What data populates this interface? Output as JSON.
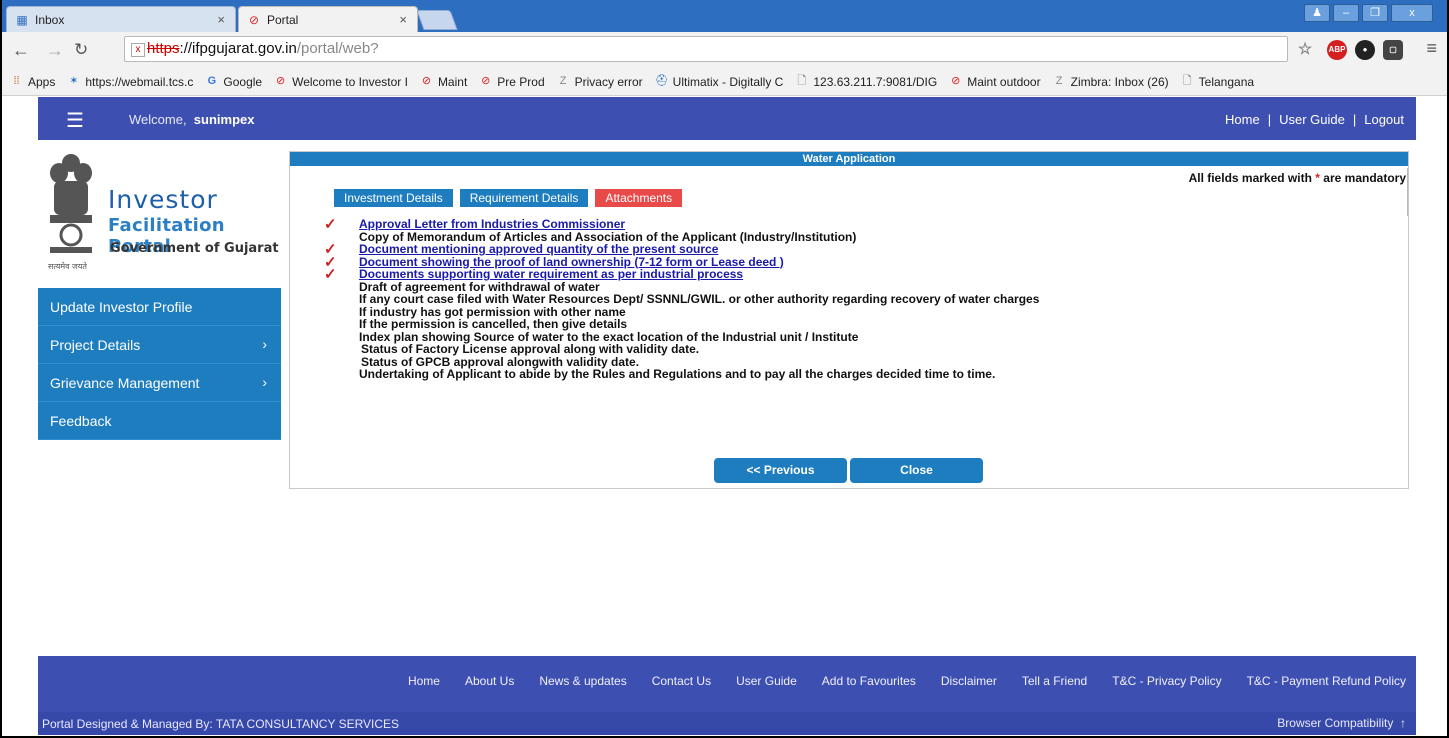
{
  "browser": {
    "tabs": [
      {
        "title": "Inbox",
        "icon": "mail-icon"
      },
      {
        "title": "Portal",
        "icon": "portal-icon"
      }
    ],
    "url": {
      "scheme": "https",
      "host": "://ifpgujarat.gov.in",
      "path": "/portal/web?"
    },
    "bookmarks": [
      "Apps",
      "https://webmail.tcs.c",
      "Google",
      "Welcome to Investor I",
      "Maint",
      "Pre Prod",
      "Privacy error",
      "Ultimatix - Digitally C",
      "123.63.211.7:9081/DIG",
      "Maint outdoor",
      "Zimbra: Inbox (26)",
      "Telangana"
    ]
  },
  "header": {
    "welcome_prefix": "Welcome,",
    "username": "sunimpex",
    "links": [
      "Home",
      "User Guide",
      "Logout"
    ],
    "separator": "|"
  },
  "logo": {
    "line1": "Investor",
    "line2": "Facilitation Portal",
    "line3": "Government of Gujarat",
    "motto": "सत्यमेव जयते"
  },
  "sidebar": {
    "items": [
      {
        "label": "Update Investor Profile",
        "chevron": false
      },
      {
        "label": "Project Details",
        "chevron": true
      },
      {
        "label": "Grievance Management",
        "chevron": true
      },
      {
        "label": "Feedback",
        "chevron": false
      }
    ]
  },
  "content": {
    "title": "Water Application",
    "mandatory_prefix": "All fields marked with",
    "mandatory_star": "*",
    "mandatory_suffix": "are mandatory",
    "tabs": [
      "Investment Details",
      "Requirement Details",
      "Attachments"
    ],
    "documents": [
      {
        "text": "Approval Letter from Industries Commissioner",
        "checked": true,
        "link": true
      },
      {
        "text": "Copy of Memorandum of Articles and Association of the Applicant (Industry/Institution)",
        "checked": false,
        "link": false
      },
      {
        "text": "Document mentioning approved quantity of the present source",
        "checked": true,
        "link": true
      },
      {
        "text": "Document showing the proof of land ownership (7-12 form or Lease deed )",
        "checked": true,
        "link": true
      },
      {
        "text": "Documents supporting water requirement as per industrial process",
        "checked": true,
        "link": true
      },
      {
        "text": "Draft of agreement for withdrawal of water",
        "checked": false,
        "link": false
      },
      {
        "text": "If any court case filed with Water Resources Dept/ SSNNL/GWIL. or other authority regarding recovery of water charges",
        "checked": false,
        "link": false
      },
      {
        "text": "If industry has got permission with other name",
        "checked": false,
        "link": false
      },
      {
        "text": "If the permission is cancelled, then give details",
        "checked": false,
        "link": false
      },
      {
        "text": "Index plan showing Source of water to the exact location of the Industrial unit / Institute",
        "checked": false,
        "link": false
      },
      {
        "text": "Status of Factory License approval along with validity date.",
        "checked": false,
        "link": false
      },
      {
        "text": "Status of GPCB approval alongwith validity date.",
        "checked": false,
        "link": false
      },
      {
        "text": "Undertaking of Applicant to abide by the Rules and Regulations and to pay all the charges decided time to time.",
        "checked": false,
        "link": false
      }
    ],
    "buttons": {
      "previous": "<< Previous",
      "close": "Close"
    }
  },
  "footer": {
    "links": [
      "Home",
      "About Us",
      "News & updates",
      "Contact Us",
      "User Guide",
      "Add to Favourites",
      "Disclaimer",
      "Tell a Friend",
      "T&C - Privacy Policy",
      "T&C - Payment Refund Policy"
    ],
    "designed_by": "Portal Designed & Managed By: TATA CONSULTANCY SERVICES",
    "compatibility": "Browser Compatibility",
    "up_arrow": "↑"
  },
  "colors": {
    "nav_blue": "#3d4fb0",
    "accent_blue": "#1e7dbf",
    "attach_red": "#e84a4a",
    "check_red": "#cc1f1f",
    "link_blue": "#1a1aaa"
  }
}
